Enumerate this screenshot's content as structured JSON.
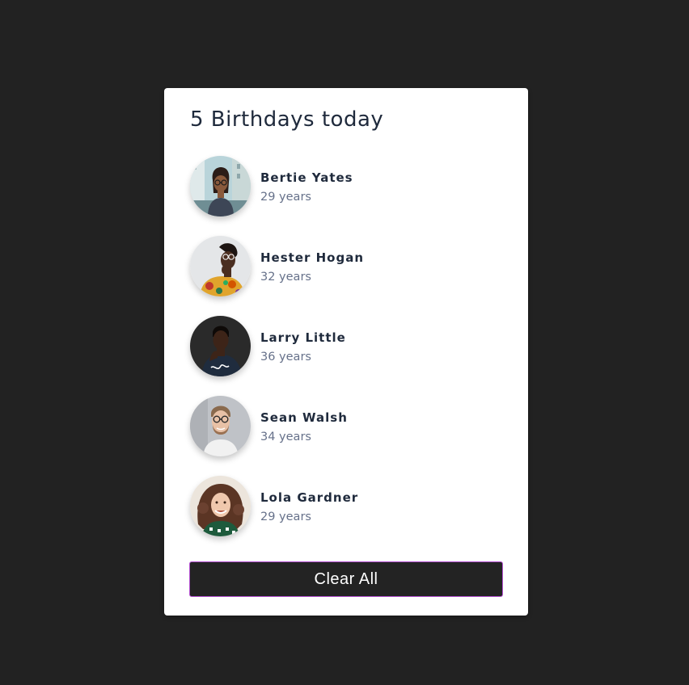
{
  "card": {
    "title": "5 Birthdays today",
    "people": [
      {
        "name": "Bertie Yates",
        "age": "29 years",
        "avatar_icon": "avatar-photo-woman-glasses-city"
      },
      {
        "name": "Hester Hogan",
        "age": "32 years",
        "avatar_icon": "avatar-photo-woman-glasses-floral"
      },
      {
        "name": "Larry Little",
        "age": "36 years",
        "avatar_icon": "avatar-photo-man-dark-shirt"
      },
      {
        "name": "Sean Walsh",
        "age": "34 years",
        "avatar_icon": "avatar-photo-man-glasses-beard"
      },
      {
        "name": "Lola Gardner",
        "age": "29 years",
        "avatar_icon": "avatar-photo-woman-curly-hair"
      }
    ],
    "clear_label": "Clear All"
  },
  "colors": {
    "page_background": "#222222",
    "card_background": "#ffffff",
    "title_text": "#1f2a3c",
    "age_text": "#66718a",
    "button_background": "#232323",
    "button_border": "#b34fd1",
    "button_text": "#ffffff"
  }
}
